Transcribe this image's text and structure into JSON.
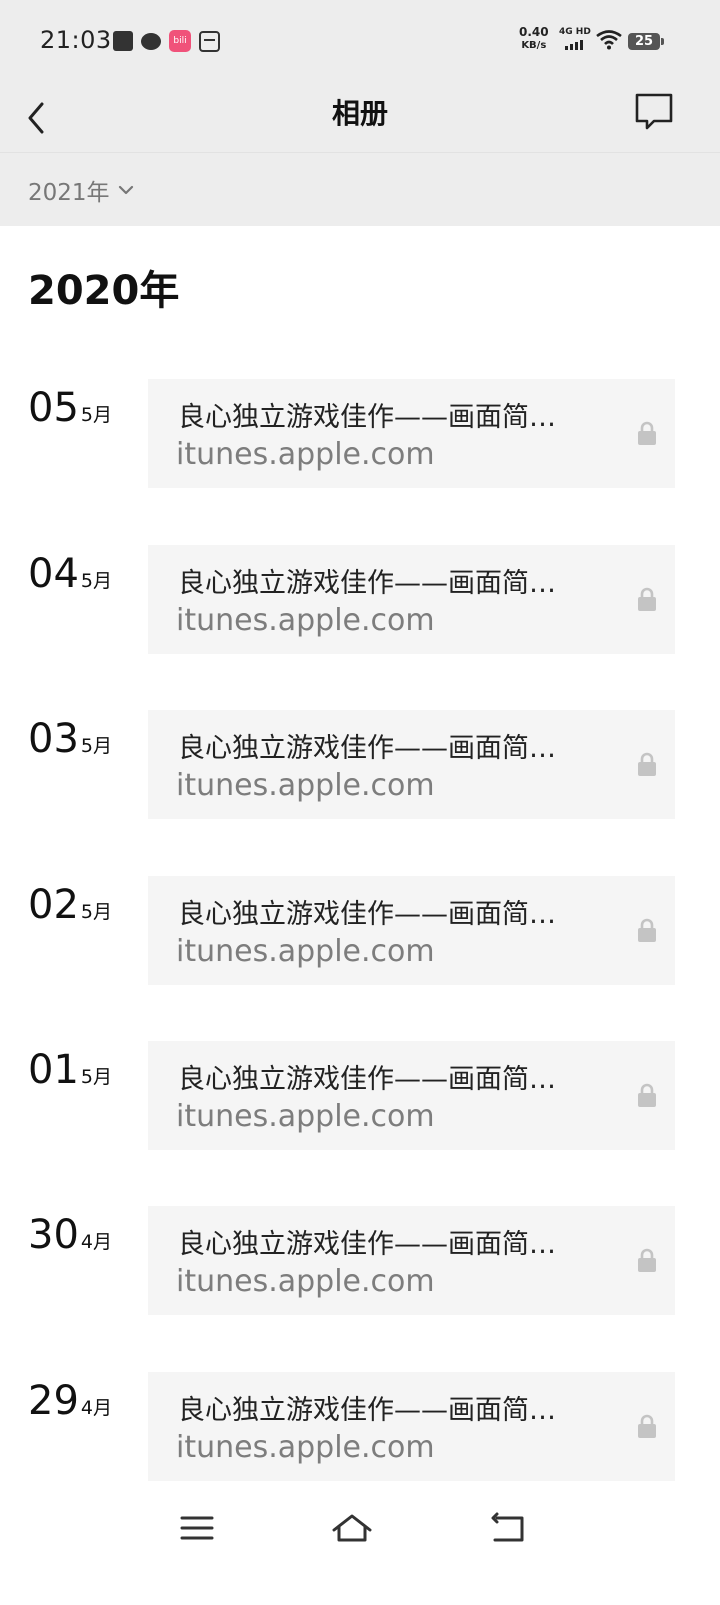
{
  "status_bar": {
    "time": "21:03",
    "app_icon_text": "bili",
    "net_speed_value": "0.40",
    "net_speed_unit": "KB/s",
    "signal_label": "4G HD",
    "battery": "25"
  },
  "header": {
    "title": "相册",
    "back_icon": "chevron-left-icon",
    "action_icon": "message-icon"
  },
  "filter": {
    "year_label": "2021年"
  },
  "content": {
    "year_heading": "2020年",
    "posts": [
      {
        "day": "05",
        "month": "5月",
        "title": "良心独立游戏佳作——画面简…",
        "url": "itunes.apple.com"
      },
      {
        "day": "04",
        "month": "5月",
        "title": "良心独立游戏佳作——画面简…",
        "url": "itunes.apple.com"
      },
      {
        "day": "03",
        "month": "5月",
        "title": "良心独立游戏佳作——画面简…",
        "url": "itunes.apple.com"
      },
      {
        "day": "02",
        "month": "5月",
        "title": "良心独立游戏佳作——画面简…",
        "url": "itunes.apple.com"
      },
      {
        "day": "01",
        "month": "5月",
        "title": "良心独立游戏佳作——画面简…",
        "url": "itunes.apple.com"
      },
      {
        "day": "30",
        "month": "4月",
        "title": "良心独立游戏佳作——画面简…",
        "url": "itunes.apple.com"
      },
      {
        "day": "29",
        "month": "4月",
        "title": "良心独立游戏佳作——画面简…",
        "url": "itunes.apple.com"
      }
    ]
  },
  "colors": {
    "header_bg": "#ededed",
    "card_bg": "#f5f5f5",
    "url_text": "#7d7d7d"
  }
}
